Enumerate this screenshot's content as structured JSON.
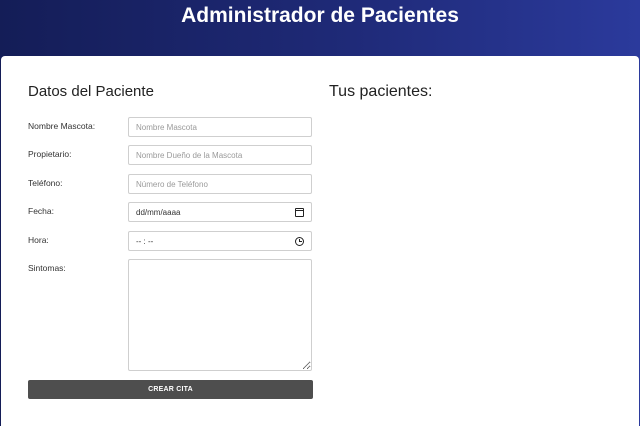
{
  "header": {
    "title": "Administrador de Pacientes"
  },
  "form": {
    "title": "Datos del Paciente",
    "fields": {
      "mascota": {
        "label": "Nombre Mascota:",
        "placeholder": "Nombre Mascota"
      },
      "propietario": {
        "label": "Propietario:",
        "placeholder": "Nombre Dueño de la Mascota"
      },
      "telefono": {
        "label": "Teléfono:",
        "placeholder": "Número de Teléfono"
      },
      "fecha": {
        "label": "Fecha:",
        "value": "dd/mm/aaaa",
        "icon": "calendar-icon"
      },
      "hora": {
        "label": "Hora:",
        "value": "-- : --",
        "icon": "clock-icon"
      },
      "sintomas": {
        "label": "Sintomas:",
        "value": ""
      }
    },
    "submit_label": "CREAR CITA"
  },
  "patients": {
    "title": "Tus pacientes:"
  },
  "colors": {
    "header_from": "#141d57",
    "header_to": "#2b3a9c",
    "button_bg": "#4e4e4e"
  }
}
